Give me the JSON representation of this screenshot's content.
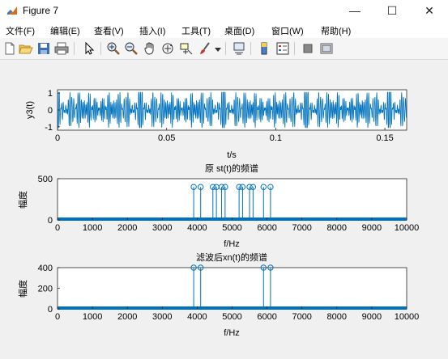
{
  "window": {
    "title": "Figure 7",
    "minimize": "—",
    "maximize": "☐",
    "close": "✕"
  },
  "menu": [
    {
      "label": "文件(F)"
    },
    {
      "label": "编辑(E)"
    },
    {
      "label": "查看(V)"
    },
    {
      "label": "插入(I)"
    },
    {
      "label": "工具(T)"
    },
    {
      "label": "桌面(D)"
    },
    {
      "label": "窗口(W)"
    },
    {
      "label": "帮助(H)"
    }
  ],
  "toolbar": [
    "new-figure-icon",
    "open-folder-icon",
    "save-icon",
    "print-icon",
    "pointer-icon",
    "zoom-in-icon",
    "zoom-out-icon",
    "pan-hand-icon",
    "rotate-3d-icon",
    "data-cursor-icon",
    "brush-icon",
    "link-plot-icon",
    "colorbar-icon",
    "legend-icon",
    "hide-plot-tools-icon",
    "show-plot-tools-icon"
  ],
  "colors": {
    "line": "#0072bd",
    "axes_bg": "#ffffff",
    "figure_bg": "#f0f0f0"
  },
  "chart_data": [
    {
      "type": "line",
      "title": "",
      "ylabel": "y3(t)",
      "xlabel": "t/s",
      "xlim": [
        0,
        0.16
      ],
      "ylim": [
        -1.2,
        1.2
      ],
      "xticks": [
        "0",
        "0.05",
        "0.1",
        "0.15"
      ],
      "yticks": [
        "-1",
        "0",
        "1"
      ],
      "series": [
        {
          "components_hz": [
            4000,
            4100,
            4500,
            4600,
            4800,
            5200,
            5300,
            5600,
            5900,
            6100
          ],
          "note_shape": "dense oscillating signal"
        }
      ]
    },
    {
      "type": "stem",
      "title": "原 st(t)的频谱",
      "ylabel": "幅度",
      "xlabel": "f/Hz",
      "xlim": [
        0,
        10000
      ],
      "ylim": [
        0,
        500
      ],
      "xticks": [
        "0",
        "1000",
        "2000",
        "3000",
        "4000",
        "5000",
        "6000",
        "7000",
        "8000",
        "9000",
        "10000"
      ],
      "yticks": [
        "0",
        "500"
      ],
      "peaks_x": [
        3900,
        4100,
        4450,
        4550,
        4700,
        4800,
        5200,
        5300,
        5500,
        5600,
        5900,
        6100
      ],
      "peak_value": 400
    },
    {
      "type": "stem",
      "title": "滤波后xn(t)的频谱",
      "ylabel": "幅度",
      "xlabel": "f/Hz",
      "xlim": [
        0,
        10000
      ],
      "ylim": [
        0,
        400
      ],
      "xticks": [
        "0",
        "1000",
        "2000",
        "3000",
        "4000",
        "5000",
        "6000",
        "7000",
        "8000",
        "9000",
        "10000"
      ],
      "yticks": [
        "0",
        "200",
        "400"
      ],
      "peaks_x": [
        3900,
        4100,
        5900,
        6100
      ],
      "peak_value": 400
    }
  ]
}
